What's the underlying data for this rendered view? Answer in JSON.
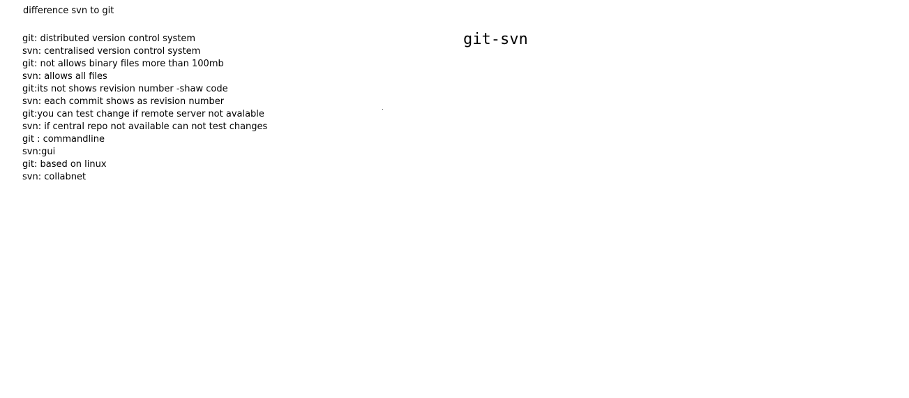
{
  "document": {
    "heading": "difference svn to git",
    "side_title": "git-svn",
    "notes": [
      "git: distributed version control system",
      "svn: centralised version control system",
      "git: not allows binary files more than 100mb",
      "svn: allows all files",
      "git:its not shows revision number -shaw code",
      "svn: each commit shows as revision number",
      "git:you can test change if remote server not avalable",
      "svn: if central repo not available can not test changes",
      "git : commandline",
      "svn:gui",
      "git: based on linux",
      "svn: collabnet"
    ]
  }
}
